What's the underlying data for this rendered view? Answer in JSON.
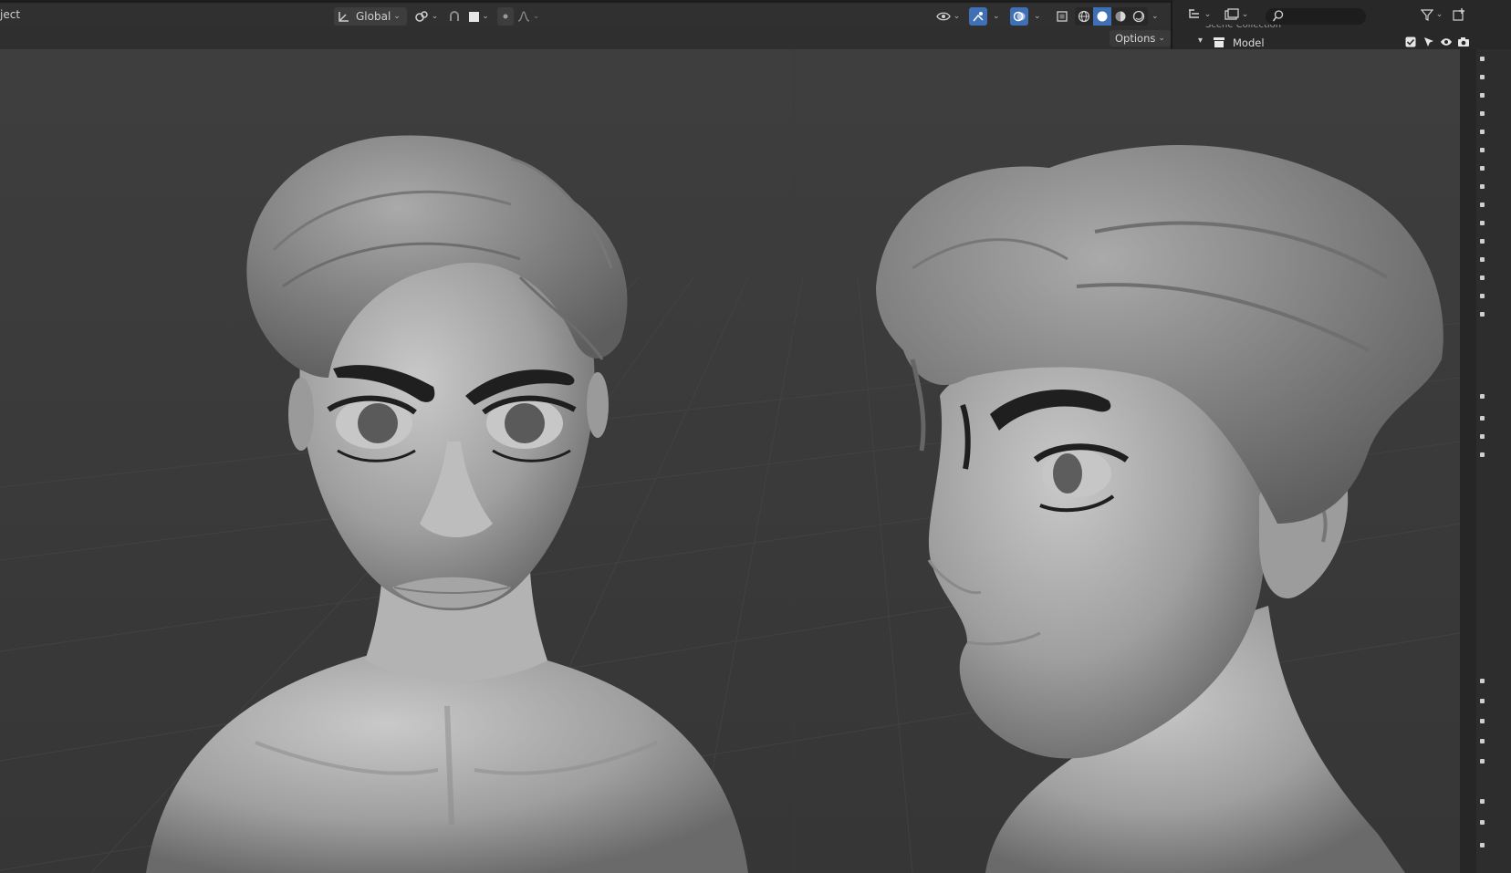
{
  "header": {
    "mode_label": "ject",
    "orientation_label": "Global",
    "options_label": "Options"
  },
  "outliner": {
    "scene_collection_label": "Scene Collection",
    "row_label": "Model"
  },
  "colors": {
    "header_bg": "#303030",
    "viewport_bg": "#3b3b3b",
    "accent_blue": "#3f6fb5",
    "outliner_bg": "#282828"
  },
  "icons": [
    "transform-orientation-icon",
    "pivot-icon",
    "snap-icon",
    "proportional-edit-icon",
    "visibility-icon",
    "gizmo-icon",
    "overlay-icon",
    "xray-icon",
    "shading-wireframe-icon",
    "shading-solid-icon",
    "shading-material-icon",
    "shading-rendered-icon",
    "outliner-display-icon",
    "filter-icon",
    "new-collection-icon",
    "search-icon",
    "checkbox-icon",
    "select-arrow-icon",
    "eye-icon",
    "camera-icon"
  ]
}
